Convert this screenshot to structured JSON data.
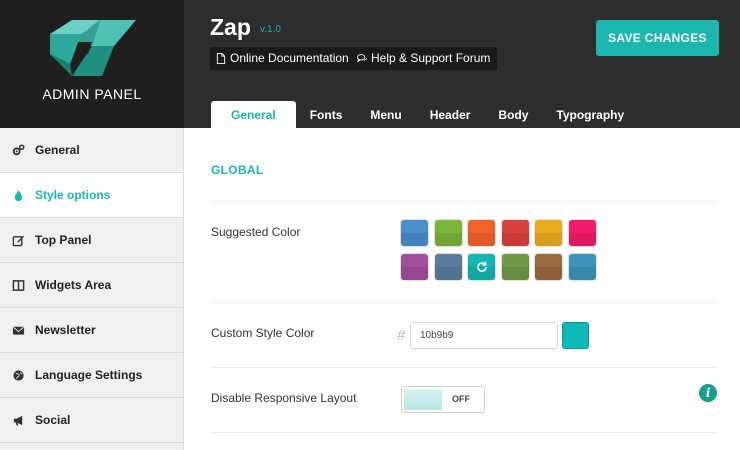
{
  "brand": {
    "label": "ADMIN PANEL"
  },
  "header": {
    "title": "Zap",
    "version": "v.1.0",
    "docs_label": "Online Documentation",
    "help_label": "Help & Support Forum",
    "save_label": "SAVE CHANGES"
  },
  "tabs": [
    "General",
    "Fonts",
    "Menu",
    "Header",
    "Body",
    "Typography"
  ],
  "sidebar": {
    "items": [
      {
        "label": "General",
        "icon": "gears-icon"
      },
      {
        "label": "Style options",
        "icon": "drop-icon"
      },
      {
        "label": "Top Panel",
        "icon": "edit-icon"
      },
      {
        "label": "Widgets Area",
        "icon": "columns-icon"
      },
      {
        "label": "Newsletter",
        "icon": "envelope-icon"
      },
      {
        "label": "Language Settings",
        "icon": "globe-icon"
      },
      {
        "label": "Social",
        "icon": "bullhorn-icon"
      }
    ]
  },
  "main": {
    "section_title": "GLOBAL",
    "suggested_color_label": "Suggested Color",
    "custom_color_label": "Custom Style Color",
    "custom_color_value": "10b9b9",
    "responsive_label": "Disable Responsive Layout",
    "toggle_state": "OFF",
    "info_glyph": "i"
  },
  "colors": {
    "accent": "#1bb7ae",
    "swatches": [
      "#4a8fc9",
      "#7bb53a",
      "#f2622d",
      "#d9413d",
      "#e8ad1f",
      "#f01c6b",
      "#a24f9e",
      "#5a7c9a",
      "#12b5b0",
      "#6f9a45",
      "#9b6a3f",
      "#3f95b9"
    ],
    "custom_preview": "#10b9b9"
  }
}
